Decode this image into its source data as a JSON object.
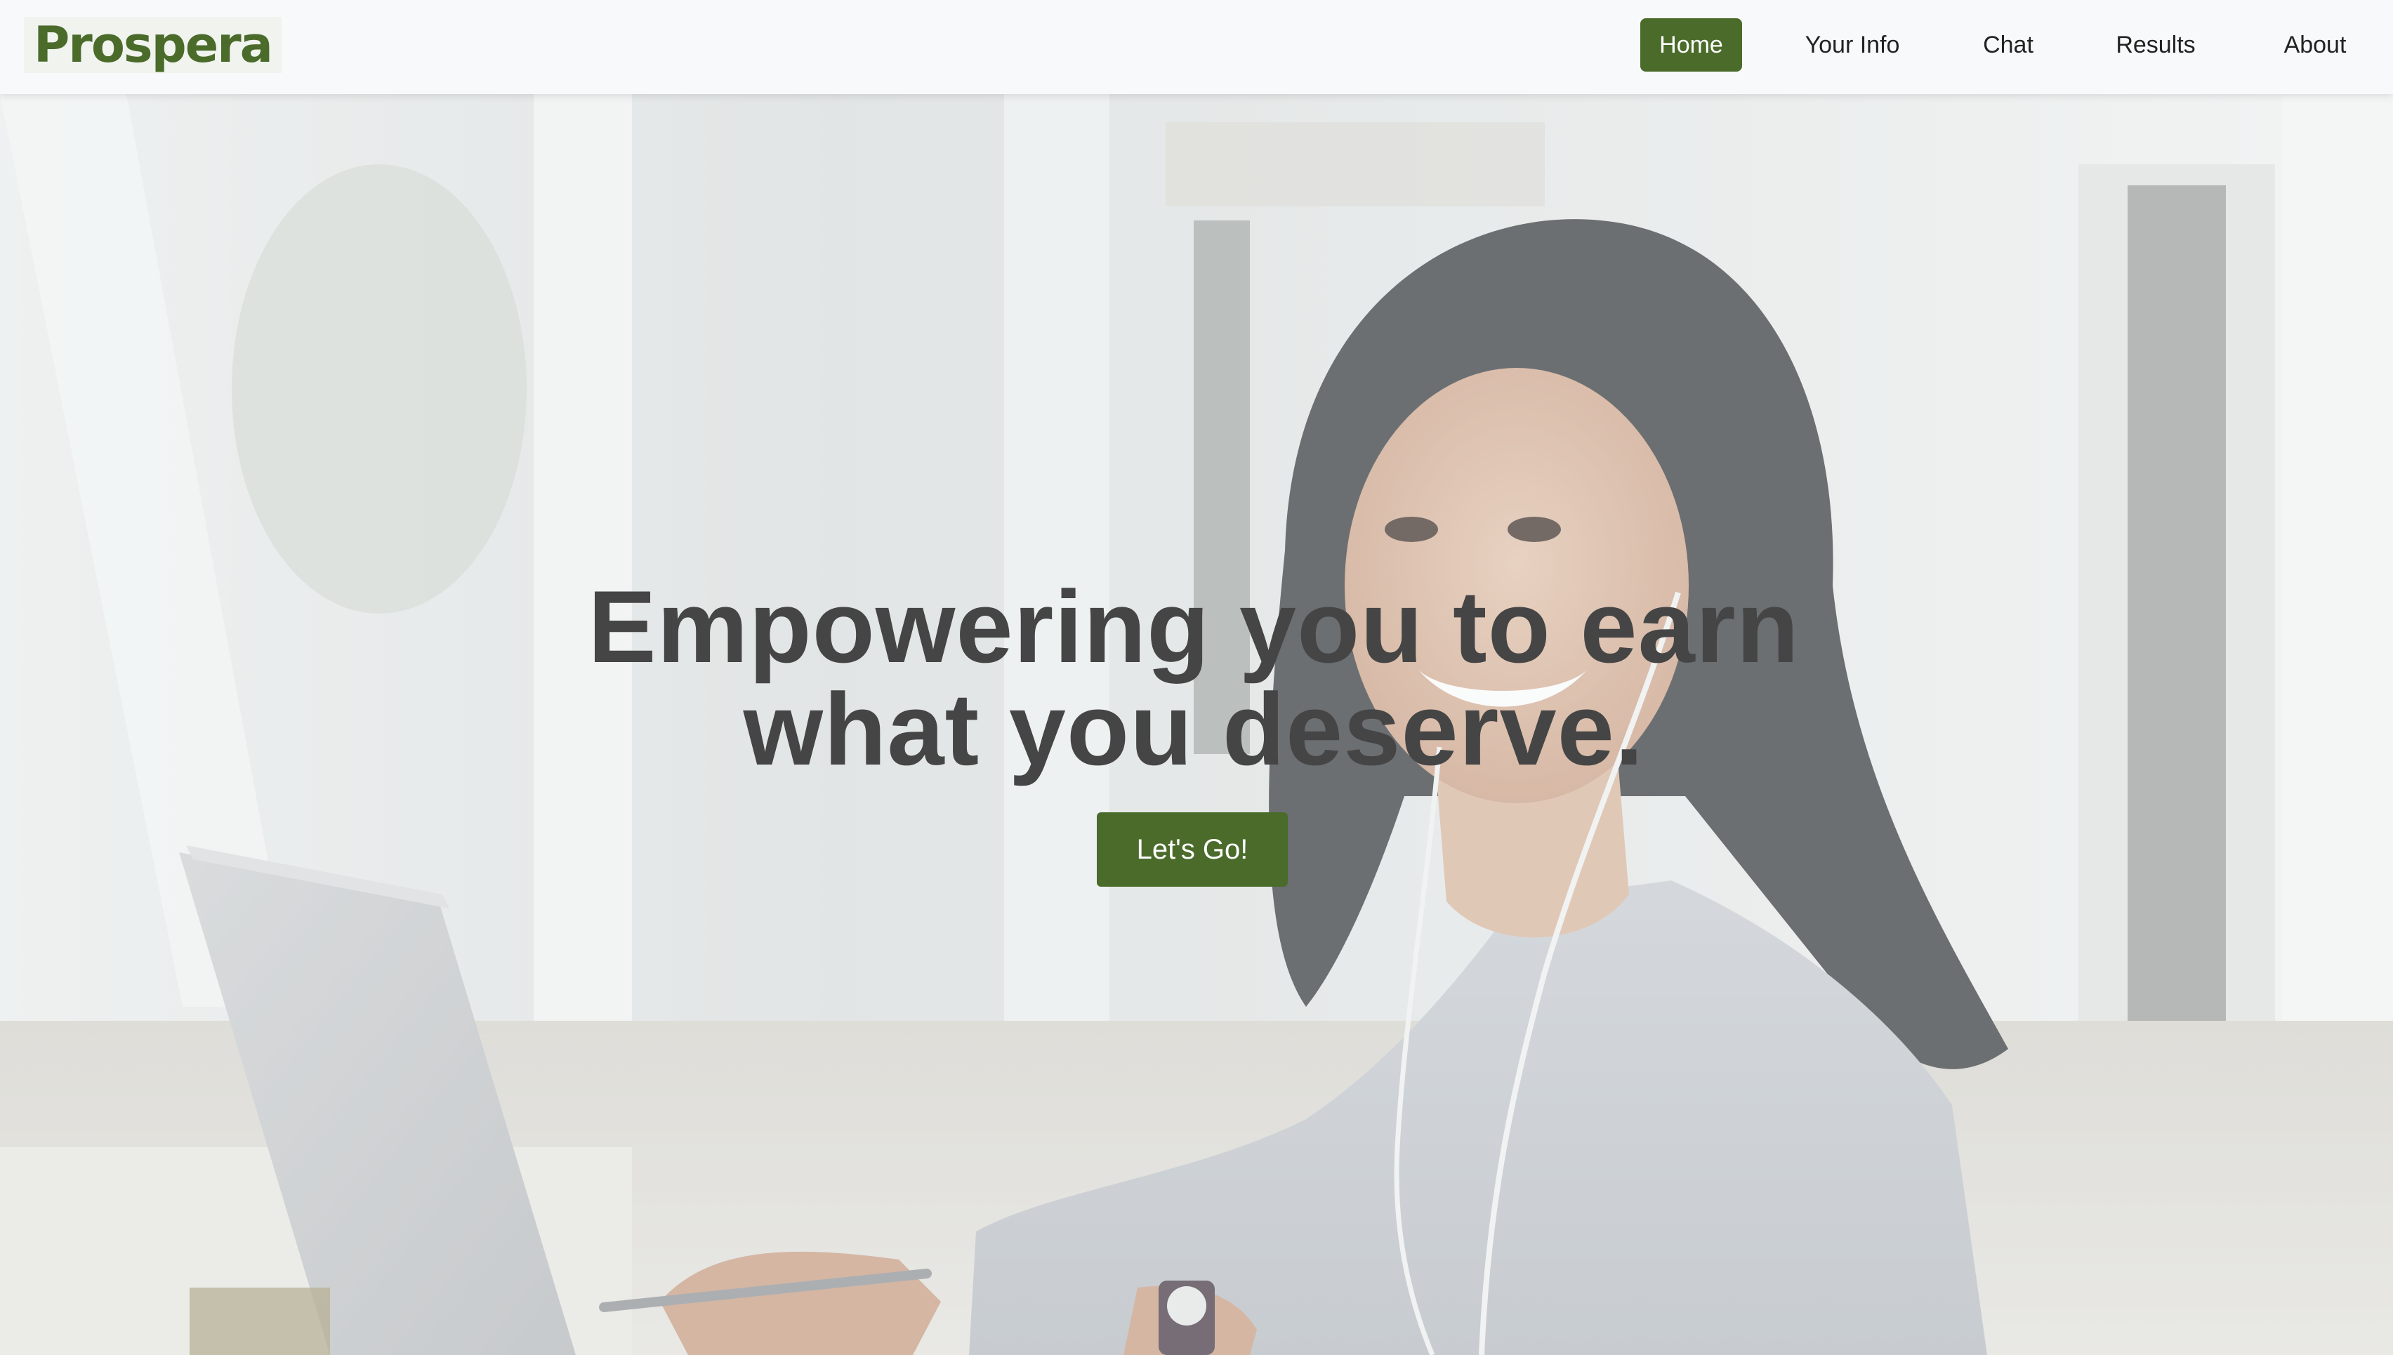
{
  "brand": {
    "name": "Prospera",
    "color": "#4a6b2a"
  },
  "nav": {
    "items": [
      {
        "label": "Home",
        "active": true
      },
      {
        "label": "Your Info",
        "active": false
      },
      {
        "label": "Chat",
        "active": false
      },
      {
        "label": "Results",
        "active": false
      },
      {
        "label": "About",
        "active": false
      }
    ]
  },
  "hero": {
    "headline_line1": "Empowering you to earn",
    "headline_line2": "what you deserve.",
    "cta_label": "Let's Go!",
    "background": "photo-woman-at-laptop-with-earphones"
  },
  "colors": {
    "accent": "#4a6b2a",
    "navbar_bg": "#f8f9fa",
    "headline": "#454545"
  }
}
